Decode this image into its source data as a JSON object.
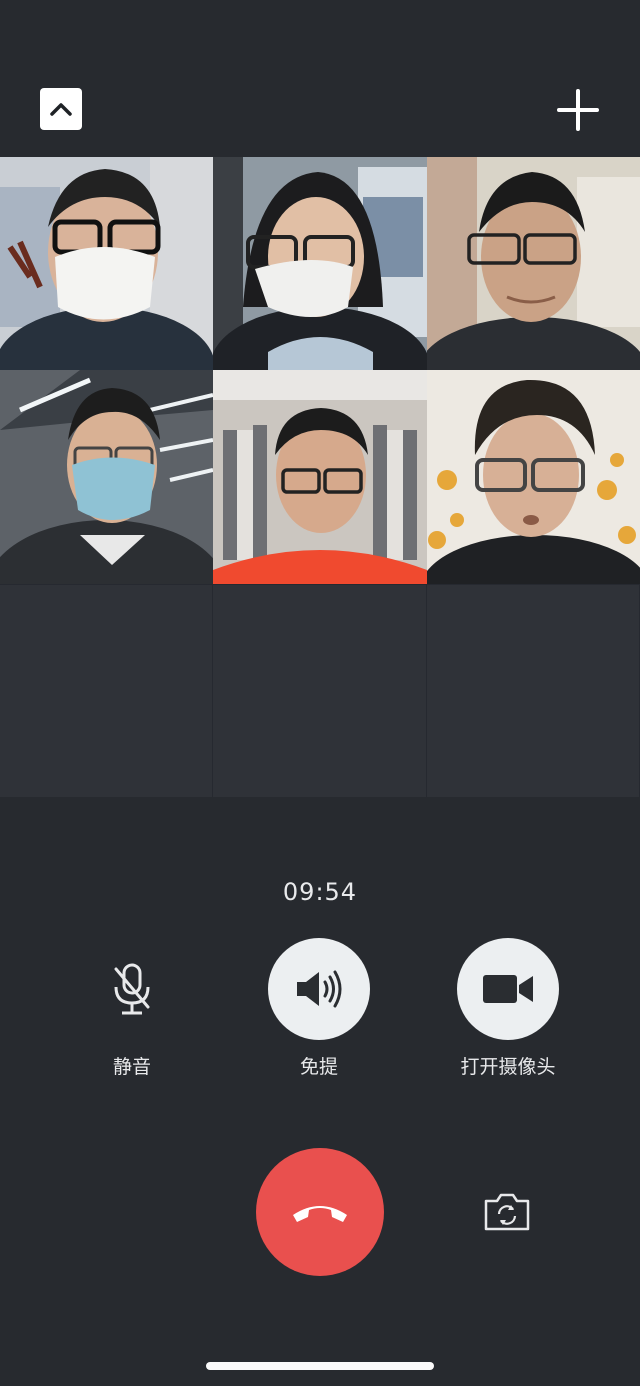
{
  "call": {
    "timer": "09:54",
    "participants_count": 6
  },
  "topbar": {
    "collapse_icon": "chevron-up-icon",
    "add_icon": "plus-icon"
  },
  "controls": {
    "mute_label": "静音",
    "speaker_label": "免提",
    "camera_label": "打开摄像头",
    "hangup_icon": "hang-up-icon",
    "flip_icon": "camera-flip-icon"
  },
  "colors": {
    "background": "#272a2f",
    "hangup": "#e9504e",
    "control_circle": "#eceff1"
  }
}
